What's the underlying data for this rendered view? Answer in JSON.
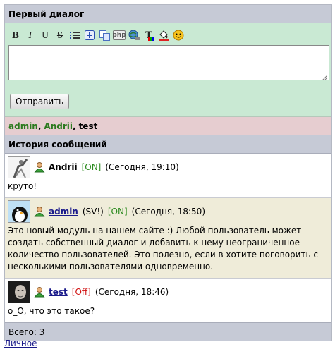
{
  "dialog": {
    "title": "Первый диалог",
    "send_label": "Отправить",
    "message_value": ""
  },
  "toolbar": [
    {
      "icon": "bold-icon",
      "glyph": "B"
    },
    {
      "icon": "italic-icon",
      "glyph": "I"
    },
    {
      "icon": "underline-icon",
      "glyph": "U"
    },
    {
      "icon": "strikethrough-icon",
      "glyph": "S"
    },
    {
      "icon": "list-icon"
    },
    {
      "icon": "insert-icon"
    },
    {
      "icon": "copy-icon"
    },
    {
      "icon": "php-icon",
      "glyph": "php"
    },
    {
      "icon": "link-icon"
    },
    {
      "icon": "text-color-icon",
      "glyph": "T"
    },
    {
      "icon": "fill-color-icon"
    },
    {
      "icon": "smiley-icon"
    }
  ],
  "participants": [
    {
      "name": "admin",
      "online": true
    },
    {
      "name": "Andrii",
      "online": true
    },
    {
      "name": "test",
      "online": false
    }
  ],
  "history": {
    "title": "История сообщений",
    "messages": [
      {
        "author": "Andrii",
        "author_linked": false,
        "role": "",
        "status": "[ON]",
        "time": "(Сегодня, 19:10)",
        "text": "круто!"
      },
      {
        "author": "admin",
        "author_linked": true,
        "role": "(SV!)",
        "status": "[ON]",
        "time": "(Сегодня, 18:50)",
        "text": "Это новый модуль на нашем сайте :) Любой пользователь может создать собственный диалог и добавить к нему неограниченное количество пользователей. Это полезно, если в хотите поговорить с несколькими пользователями одновременно."
      },
      {
        "author": "test",
        "author_linked": true,
        "role": "",
        "status": "[Off]",
        "time": "(Сегодня, 18:46)",
        "text": "о_О, что это такое?"
      }
    ],
    "total": "Всего: 3"
  },
  "bottom_link": "Личное",
  "colors": {
    "header_bg": "#c6cad6",
    "editor_bg": "#c9e9d3",
    "participants_bg": "#e6cdd0",
    "alt_msg_bg": "#efecd9",
    "online": "#2b8a1e",
    "offline": "#d01010",
    "link": "#1a1a8a"
  }
}
